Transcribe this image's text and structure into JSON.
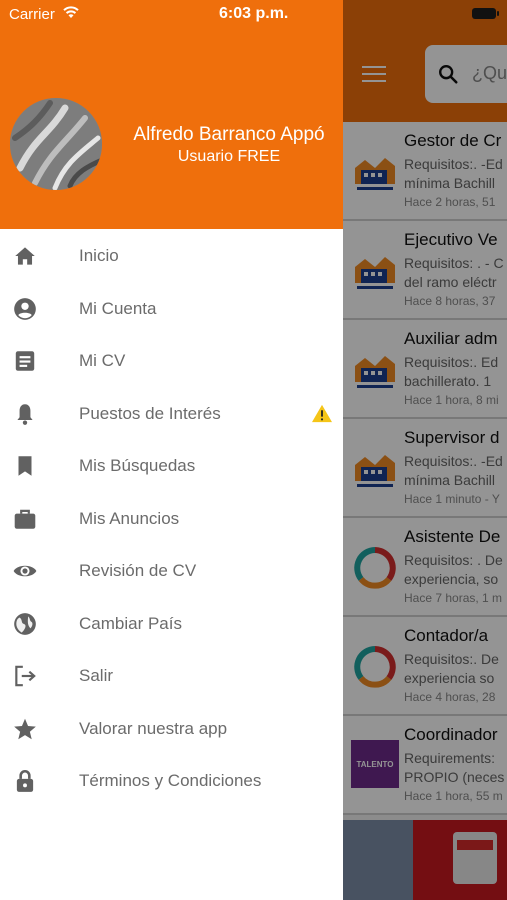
{
  "status_bar": {
    "carrier": "Carrier",
    "time": "6:03 p.m."
  },
  "drawer": {
    "user_name": "Alfredo Barranco Appó",
    "user_plan": "Usuario FREE",
    "items": [
      {
        "label": "Inicio",
        "icon": "home-icon"
      },
      {
        "label": "Mi Cuenta",
        "icon": "account-icon"
      },
      {
        "label": "Mi CV",
        "icon": "document-icon"
      },
      {
        "label": "Puestos de Interés",
        "icon": "bell-icon",
        "badge_icon": "warning-icon"
      },
      {
        "label": "Mis Búsquedas",
        "icon": "bookmark-icon"
      },
      {
        "label": "Mis Anuncios",
        "icon": "briefcase-icon"
      },
      {
        "label": "Revisión de CV",
        "icon": "eye-icon"
      },
      {
        "label": "Cambiar País",
        "icon": "globe-icon"
      },
      {
        "label": "Salir",
        "icon": "logout-icon"
      },
      {
        "label": "Valorar nuestra app",
        "icon": "star-icon"
      },
      {
        "label": "Términos y Condiciones",
        "icon": "lock-icon"
      }
    ]
  },
  "background": {
    "search_placeholder": "¿Qué",
    "jobs": [
      {
        "title": "Gestor de Cr",
        "req_line1": "Requisitos:. -Ed",
        "req_line2": "mínima Bachill",
        "time": "Hace 2 horas, 51",
        "logo": "building"
      },
      {
        "title": "Ejecutivo Ve",
        "req_line1": "Requisitos: . - C",
        "req_line2": "del ramo eléctr",
        "time": "Hace 8 horas, 37",
        "logo": "building"
      },
      {
        "title": "Auxiliar adm",
        "req_line1": "Requisitos:. Ed",
        "req_line2": "bachillerato. 1",
        "time": "Hace 1 hora, 8 mi",
        "logo": "building"
      },
      {
        "title": "Supervisor d",
        "req_line1": "Requisitos:. -Ed",
        "req_line2": "mínima Bachill",
        "time": "Hace 1 minuto - Y",
        "logo": "building"
      },
      {
        "title": "Asistente De",
        "req_line1": "Requisitos: . De",
        "req_line2": "experiencia, so",
        "time": "Hace 7 horas, 1 m",
        "logo": "ring"
      },
      {
        "title": "Contador/a",
        "req_line1": "Requisitos:. De",
        "req_line2": "experiencia so",
        "time": "Hace 4 horas, 28",
        "logo": "ring"
      },
      {
        "title": "Coordinador",
        "req_line1": "Requirements: ",
        "req_line2": "PROPIO (neces",
        "time": "Hace 1 hora, 55 m",
        "logo": "talento",
        "logo_text": "TALENTO"
      }
    ]
  },
  "colors": {
    "brand_orange": "#ef6f0c",
    "warning_yellow": "#f5c518",
    "icon_gray": "#616161"
  }
}
